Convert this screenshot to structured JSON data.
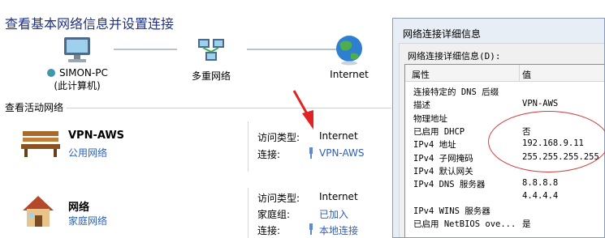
{
  "page": {
    "title": "查看基本网络信息并设置连接"
  },
  "map": {
    "nodes": [
      {
        "name": "SIMON-PC",
        "sub": "(此计算机)",
        "icon": "computer-icon"
      },
      {
        "name": "多重网络",
        "icon": "multiple-networks-icon"
      },
      {
        "name": "Internet",
        "icon": "globe-icon"
      }
    ]
  },
  "active": {
    "heading": "查看活动网络",
    "networks": [
      {
        "name": "VPN-AWS",
        "type": "公用网络",
        "icon": "bench-icon",
        "rows": [
          {
            "key": "访问类型:",
            "value": "Internet",
            "link": false
          },
          {
            "key": "连接:",
            "value": "VPN-AWS",
            "link": true
          }
        ]
      },
      {
        "name": "网络",
        "type": "家庭网络",
        "icon": "house-icon",
        "rows": [
          {
            "key": "访问类型:",
            "value": "Internet",
            "link": false
          },
          {
            "key": "家庭组:",
            "value": "已加入",
            "link": true
          },
          {
            "key": "连接:",
            "value": "本地连接",
            "link": true
          }
        ]
      }
    ]
  },
  "dialog": {
    "title": "网络连接详细信息",
    "label": "网络连接详细信息(D):",
    "columns": [
      "属性",
      "值"
    ],
    "rows": [
      {
        "p": "连接特定的 DNS 后缀",
        "v": ""
      },
      {
        "p": "描述",
        "v": "VPN-AWS"
      },
      {
        "p": "物理地址",
        "v": ""
      },
      {
        "p": "已启用 DHCP",
        "v": "否"
      },
      {
        "p": "IPv4 地址",
        "v": "192.168.9.11"
      },
      {
        "p": "IPv4 子网掩码",
        "v": "255.255.255.255"
      },
      {
        "p": "IPv4 默认网关",
        "v": ""
      },
      {
        "p": "IPv4 DNS 服务器",
        "v": "8.8.8.8"
      },
      {
        "p": "",
        "v": "4.4.4.4"
      },
      {
        "p": "IPv4 WINS 服务器",
        "v": ""
      },
      {
        "p": "已启用 NetBIOS ove...",
        "v": "是"
      }
    ]
  },
  "colors": {
    "title": "#1e3287",
    "link": "#2e5fb8",
    "annotation": "#d23c3c"
  }
}
